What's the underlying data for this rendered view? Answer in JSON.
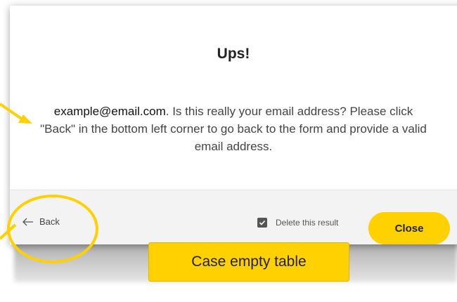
{
  "dialog": {
    "title": "Ups!",
    "message_email": "example@email.com",
    "message_rest": ". Is this really your email address? Please click \"Back\" in the bottom left corner to go back to the form and provide a valid email address."
  },
  "footer": {
    "back_label": "Back",
    "delete_label": "Delete this result",
    "delete_checked": true,
    "close_label": "Close"
  },
  "annotation": {
    "callout_text": "Case empty table"
  },
  "colors": {
    "accent": "#ffd100",
    "footer_bg": "#f3f3f3",
    "text": "#444444"
  },
  "icons": {
    "back": "arrow-left-icon",
    "checkbox": "check-icon"
  }
}
